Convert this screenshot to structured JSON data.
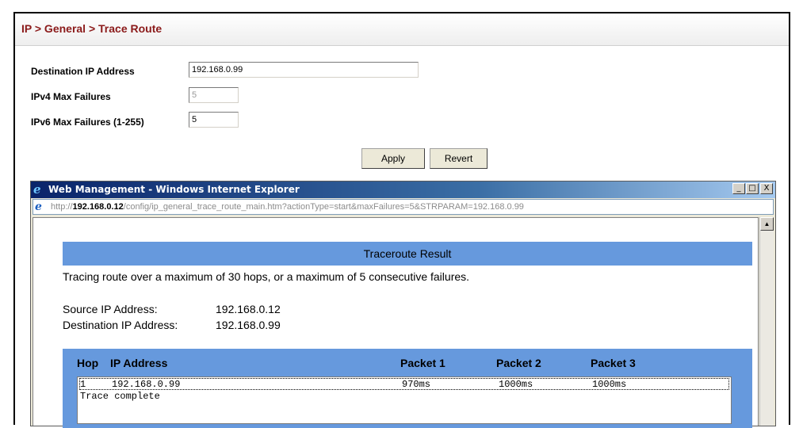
{
  "header": {
    "breadcrumb": "IP > General > Trace Route"
  },
  "form": {
    "dest_ip_label": "Destination IP Address",
    "dest_ip_value": "192.168.0.99",
    "ipv4_label": "IPv4 Max Failures",
    "ipv4_value": "5",
    "ipv6_label": "IPv6 Max Failures (1-255)",
    "ipv6_value": "5",
    "apply_label": "Apply",
    "revert_label": "Revert"
  },
  "ie_window": {
    "title": "Web Management - Windows Internet Explorer",
    "address_prefix": "http://",
    "address_host": "192.168.0.12",
    "address_path": "/config/ip_general_trace_route_main.htm?actionType=start&maxFailures=5&STRPARAM=192.168.0.99",
    "btn_minimize": "_",
    "btn_maximize": "□",
    "btn_close": "X"
  },
  "result": {
    "header": "Traceroute Result",
    "summary": "Tracing route over a maximum of 30 hops, or a maximum of 5 consecutive failures.",
    "source_label": "Source IP Address:",
    "source_value": "192.168.0.12",
    "dest_label": "Destination IP Address:",
    "dest_value": "192.168.0.99",
    "columns": {
      "hop": "Hop",
      "ip": "IP Address",
      "p1": "Packet 1",
      "p2": "Packet 2",
      "p3": "Packet 3"
    },
    "rows": [
      {
        "hop": "1",
        "ip": "192.168.0.99",
        "p1": "970ms",
        "p2": "1000ms",
        "p3": "1000ms"
      }
    ],
    "footer": "Trace complete"
  },
  "icons": {
    "ie": "ie-logo-icon",
    "address": "ie-page-icon",
    "scroll_up": "scroll-up-arrow-icon"
  },
  "colors": {
    "breadcrumb": "#8b1a1a",
    "result_header_bg": "#6699dd",
    "ie_title_start": "#0a246a"
  }
}
